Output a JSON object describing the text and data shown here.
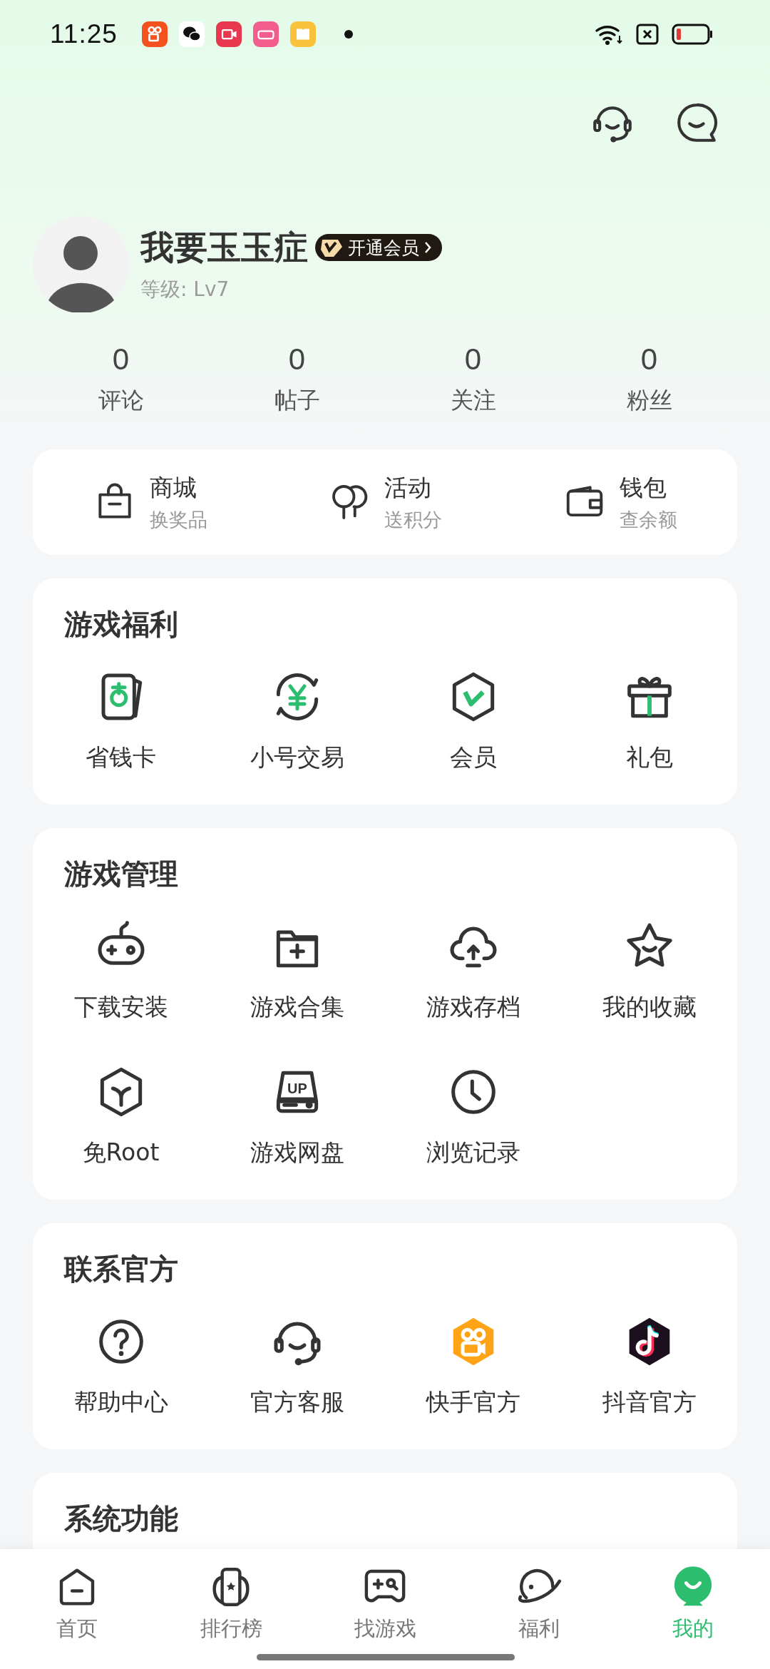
{
  "status_bar": {
    "time": "11:25"
  },
  "profile": {
    "name": "我要玉玉症",
    "vip_badge": "开通会员",
    "level": "等级: Lv7"
  },
  "stats": [
    {
      "value": "0",
      "label": "评论"
    },
    {
      "value": "0",
      "label": "帖子"
    },
    {
      "value": "0",
      "label": "关注"
    },
    {
      "value": "0",
      "label": "粉丝"
    }
  ],
  "quick_links": [
    {
      "title": "商城",
      "subtitle": "换奖品"
    },
    {
      "title": "活动",
      "subtitle": "送积分"
    },
    {
      "title": "钱包",
      "subtitle": "查余额"
    }
  ],
  "sections": [
    {
      "title": "游戏福利",
      "items": [
        {
          "label": "省钱卡"
        },
        {
          "label": "小号交易"
        },
        {
          "label": "会员"
        },
        {
          "label": "礼包"
        }
      ]
    },
    {
      "title": "游戏管理",
      "items": [
        {
          "label": "下载安装"
        },
        {
          "label": "游戏合集"
        },
        {
          "label": "游戏存档"
        },
        {
          "label": "我的收藏"
        },
        {
          "label": "免Root"
        },
        {
          "label": "游戏网盘",
          "icon_text": "UP"
        },
        {
          "label": "浏览记录"
        }
      ]
    },
    {
      "title": "联系官方",
      "items": [
        {
          "label": "帮助中心"
        },
        {
          "label": "官方客服"
        },
        {
          "label": "快手官方"
        },
        {
          "label": "抖音官方"
        }
      ]
    },
    {
      "title": "系统功能"
    }
  ],
  "bottom_nav": [
    {
      "label": "首页",
      "selected": false
    },
    {
      "label": "排行榜",
      "selected": false
    },
    {
      "label": "找游戏",
      "selected": false
    },
    {
      "label": "福利",
      "selected": false
    },
    {
      "label": "我的",
      "selected": true
    }
  ]
}
